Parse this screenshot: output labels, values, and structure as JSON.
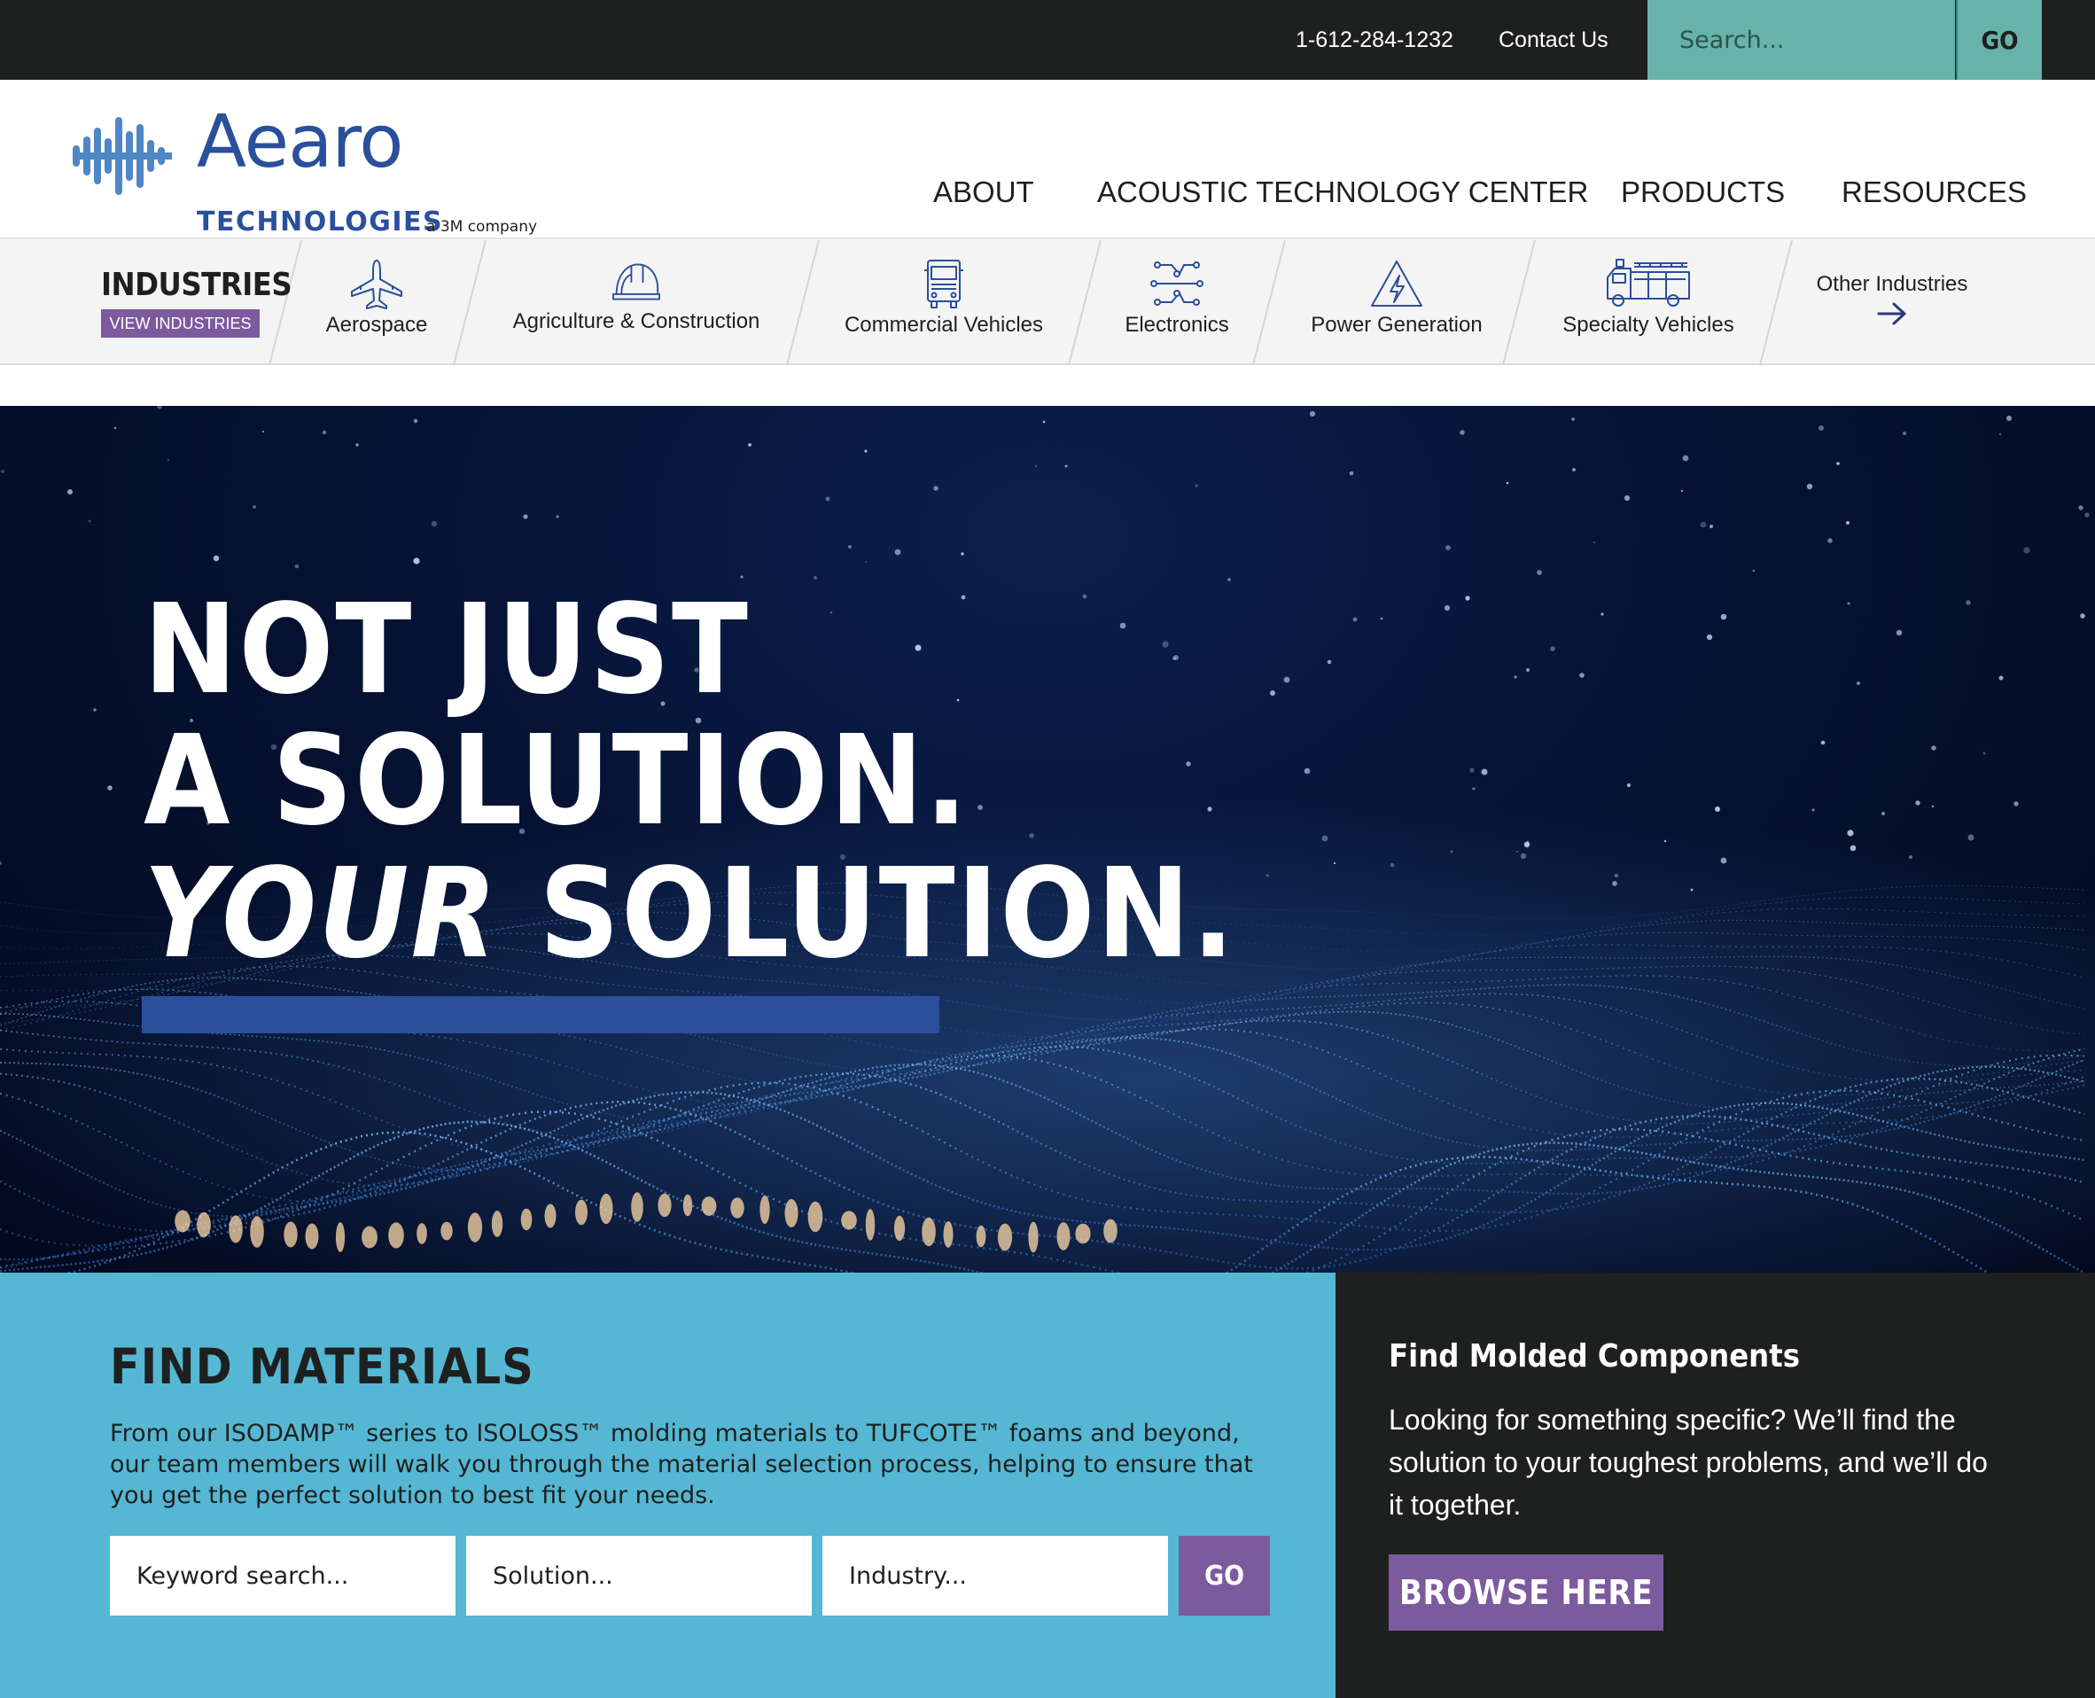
{
  "topbar": {
    "phone": "1-612-284-1232",
    "contact_label": "Contact Us",
    "search_placeholder": "Search...",
    "go_label": "GO"
  },
  "brand": {
    "name": "Aearo",
    "subtitle": "TECHNOLOGIES",
    "tagline": "a 3M company",
    "color": "#2a4f9b",
    "logo_icon": "sound-wave-icon"
  },
  "nav": {
    "items": [
      {
        "label": "ABOUT"
      },
      {
        "label": "ACOUSTIC TECHNOLOGY CENTER"
      },
      {
        "label": "PRODUCTS"
      },
      {
        "label": "RESOURCES"
      }
    ]
  },
  "industries": {
    "title": "INDUSTRIES",
    "view_label": "VIEW INDUSTRIES",
    "items": [
      {
        "label": "Aerospace",
        "icon": "airplane-icon"
      },
      {
        "label": "Agriculture & Construction",
        "icon": "hard-hat-icon"
      },
      {
        "label": "Commercial Vehicles",
        "icon": "truck-icon"
      },
      {
        "label": "Electronics",
        "icon": "circuit-icon"
      },
      {
        "label": "Power Generation",
        "icon": "lightning-warning-icon"
      },
      {
        "label": "Specialty Vehicles",
        "icon": "fire-truck-icon"
      }
    ],
    "other_label": "Other Industries",
    "other_icon": "arrow-right-icon"
  },
  "hero": {
    "line1": "NOT JUST",
    "line2": "A SOLUTION.",
    "line3_em": "YOUR",
    "line3_rest": "SOLUTION."
  },
  "materials": {
    "title": "FIND MATERIALS",
    "description": "From our ISODAMP™ series to ISOLOSS™ molding materials to TUFCOTE™ foams and beyond, our team members will walk you through the material selection process, helping to ensure that you get the perfect solution to best fit your needs.",
    "keyword_placeholder": "Keyword search...",
    "solution_placeholder": "Solution...",
    "industry_placeholder": "Industry...",
    "go_label": "GO"
  },
  "molded": {
    "title": "Find Molded Components",
    "description": "Looking for something specific? We’ll find the solution to your toughest problems, and we’ll do it together.",
    "button_label": "BROWSE HERE"
  },
  "colors": {
    "topbar_bg": "#1e201f",
    "search_bg": "#67b3a9",
    "accent_purple": "#7c5a9e",
    "materials_bg": "#55b7d3",
    "brand_blue": "#2a4f9b"
  }
}
